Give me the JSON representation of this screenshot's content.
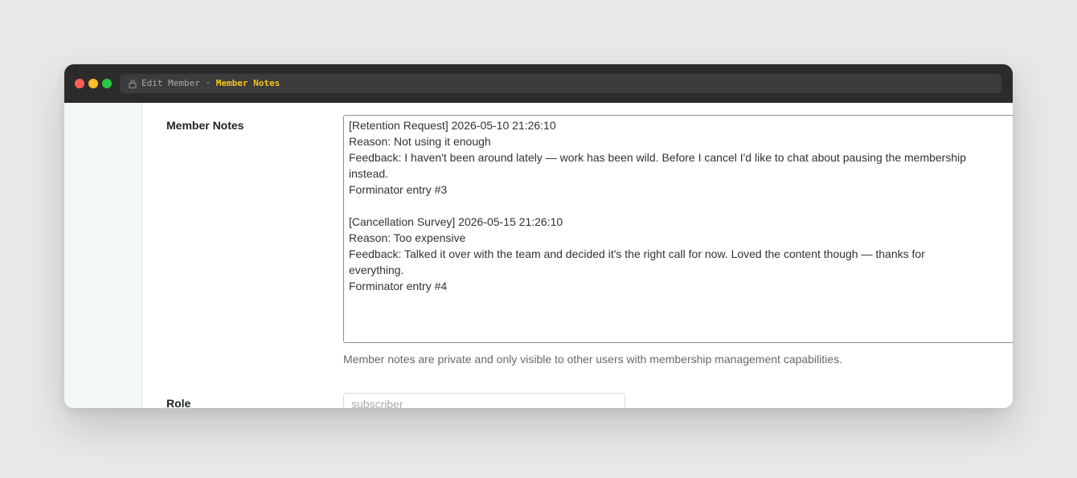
{
  "window": {
    "address": {
      "parent": "Edit Member",
      "separator": " · ",
      "current": "Member Notes"
    }
  },
  "colors": {
    "accent": "#f5c518",
    "titlebar": "#2b2b2b",
    "sidebar": "#f3f7f7"
  },
  "icons": {
    "address_lock": "lock-icon"
  },
  "form": {
    "member_notes": {
      "label": "Member Notes",
      "lines": [
        "[Retention Request] 2026-05-10 21:26:10",
        "Reason: Not using it enough",
        "Feedback: I haven't been around lately — work has been wild. Before I cancel I'd like to chat about pausing the membership",
        "instead.",
        "Forminator entry #3",
        "",
        "[Cancellation Survey] 2026-05-15 21:26:10",
        "Reason: Too expensive",
        "Feedback: Talked it over with the team and decided it's the right call for now. Loved the content though — thanks for",
        "everything.",
        "Forminator entry #4"
      ],
      "description": "Member notes are private and only visible to other users with membership management capabilities."
    },
    "role": {
      "label": "Role",
      "value": "subscriber"
    }
  }
}
